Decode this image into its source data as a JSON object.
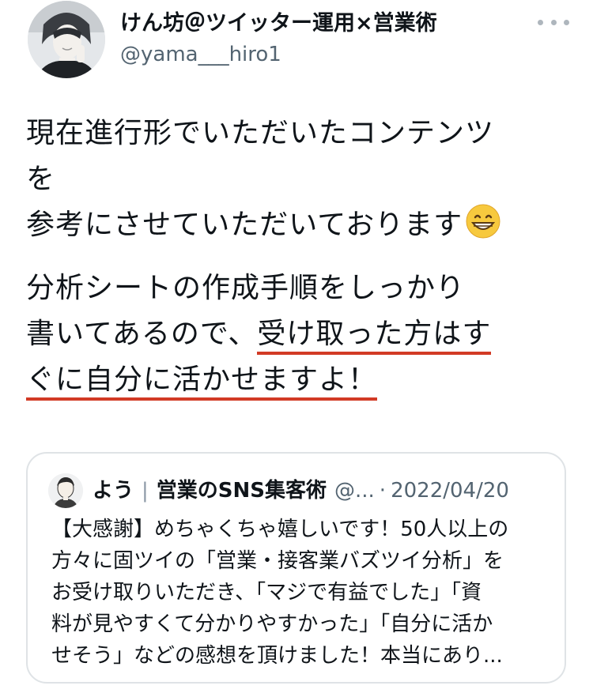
{
  "author": {
    "display_name": "けん坊＠ツイッター運用×営業術",
    "handle": "@yama___hiro1"
  },
  "tweet": {
    "paragraph1": [
      "現在進行形でいただいたコンテンツ",
      "を",
      "参考にさせていただいております"
    ],
    "emoji": "grinning-face-emoji",
    "paragraph2": {
      "line1": "分析シートの作成手順をしっかり",
      "line2_plain": "書いてあるので、",
      "line2_highlight": "受け取った方はす",
      "line3_highlight": "ぐに自分に活かせますよ！"
    },
    "highlight_color": "#d23a25"
  },
  "quoted": {
    "name": "よう",
    "separator": "|",
    "subname": "営業のSNS集客術",
    "handle": "@...",
    "dot": "·",
    "date": "2022/04/20",
    "lines": [
      "【大感謝】めちゃくちゃ嬉しいです！50人以上の",
      "方々に固ツイの「営業・接客業バズツイ分析」を",
      "お受け取りいただき、「マジで有益でした」「資",
      "料が見やすくて分かりやすかった」「自分に活か",
      "せそう」などの感想を頂けました！本当にあり..."
    ]
  }
}
